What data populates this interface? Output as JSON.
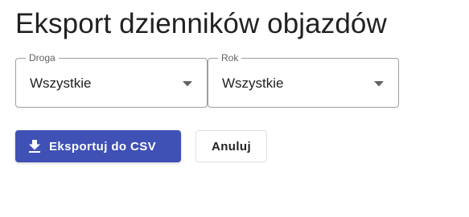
{
  "dialog": {
    "title": "Eksport dzienników objazdów"
  },
  "filters": {
    "road": {
      "label": "Droga",
      "value": "Wszystkie",
      "icon": "dropdown-arrow-icon"
    },
    "year": {
      "label": "Rok",
      "value": "Wszystkie",
      "icon": "dropdown-arrow-icon"
    }
  },
  "actions": {
    "export_label": "Eksportuj do CSV",
    "export_icon": "download-icon",
    "cancel_label": "Anuluj"
  },
  "colors": {
    "primary": "#3f51b5",
    "outline": "#9e9e9e"
  }
}
